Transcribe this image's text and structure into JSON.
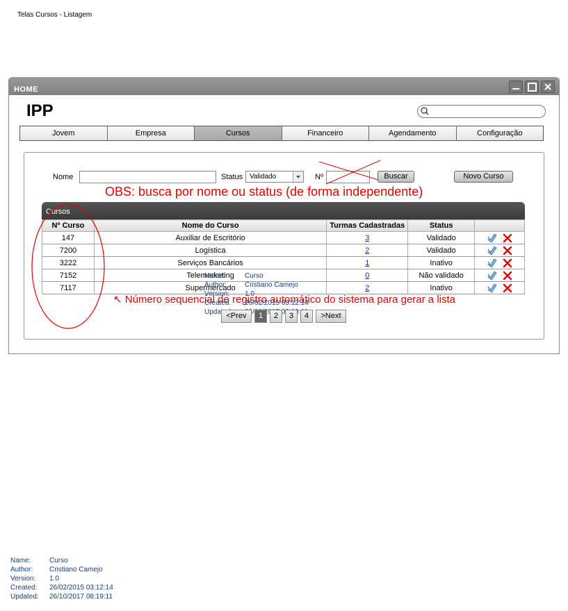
{
  "page_title": "Telas Cursos - Listagem",
  "window": {
    "title": "HOME",
    "app_title": "IPP"
  },
  "nav": [
    "Jovem",
    "Empresa",
    "Cursos",
    "Financeiro",
    "Agendamento",
    "Configuração"
  ],
  "nav_active": "Cursos",
  "filters": {
    "nome_label": "Nome",
    "status_label": "Status",
    "status_value": "Validado",
    "num_label": "Nº",
    "search_button": "Buscar",
    "new_button": "Novo Curso"
  },
  "obs_note": "OBS: busca por nome ou status (de forma independente)",
  "grid": {
    "title": "Cursos",
    "columns": [
      "Nº Curso",
      "Nome do Curso",
      "Turmas Cadastradas",
      "Status",
      ""
    ],
    "rows": [
      {
        "num": "147",
        "nome": "Auxiliar de Escritório",
        "turmas": "3",
        "status": "Validado"
      },
      {
        "num": "7200",
        "nome": "Logística",
        "turmas": "2",
        "status": "Validado"
      },
      {
        "num": "3222",
        "nome": "Serviços Bancários",
        "turmas": "1",
        "status": "Inativo"
      },
      {
        "num": "7152",
        "nome": "Telemarketing",
        "turmas": "0",
        "status": "Não validado"
      },
      {
        "num": "7117",
        "nome": "Supermercado",
        "turmas": "2",
        "status": "Inativo"
      }
    ]
  },
  "sequence_note": "Número sequencial de registro automático do sistema para gerar a lista",
  "pager": {
    "prev": "<Prev",
    "pages": [
      "1",
      "2",
      "3",
      "4"
    ],
    "active": "1",
    "next": ">Next"
  },
  "meta": {
    "labels": [
      "Name:",
      "Author:",
      "Version:",
      "Created:",
      "Updated:"
    ],
    "values": [
      "Curso",
      "Cristiano Camejo",
      "1.0",
      "26/02/2015 03:12:14",
      "26/10/2017 08:19:11"
    ]
  },
  "colors": {
    "annotation_red": "#e00000",
    "meta_blue": "#1a3c7a",
    "link_blue": "#1a1ae0"
  }
}
